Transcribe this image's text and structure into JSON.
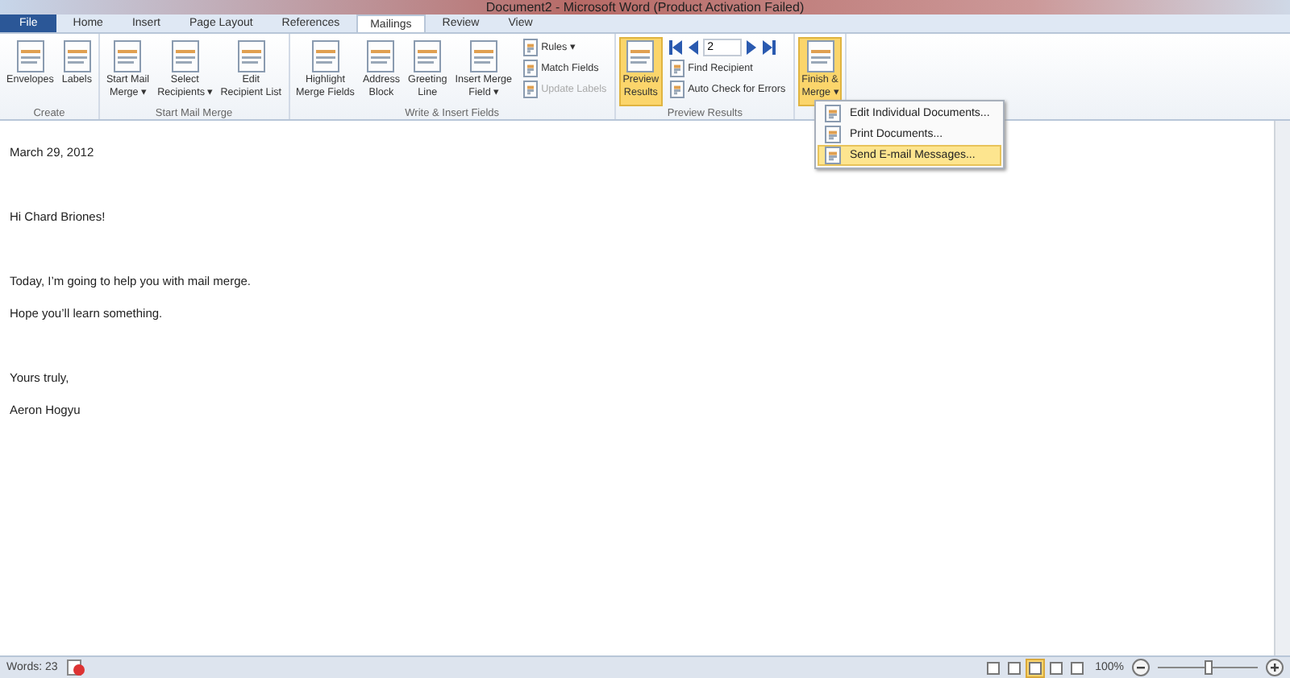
{
  "window": {
    "title": "Document2 - Microsoft Word (Product Activation Failed)"
  },
  "tabs": [
    {
      "label": "File",
      "kind": "file",
      "selected": false
    },
    {
      "label": "Home",
      "kind": "tab",
      "selected": false
    },
    {
      "label": "Insert",
      "kind": "tab",
      "selected": false
    },
    {
      "label": "Page Layout",
      "kind": "tab",
      "selected": false
    },
    {
      "label": "References",
      "kind": "tab",
      "selected": false
    },
    {
      "label": "Mailings",
      "kind": "tab",
      "selected": true
    },
    {
      "label": "Review",
      "kind": "tab",
      "selected": false
    },
    {
      "label": "View",
      "kind": "tab",
      "selected": false
    }
  ],
  "ribbon": {
    "groups": [
      {
        "label": "Create",
        "items": [
          {
            "kind": "large",
            "label": "Envelopes",
            "selected": false
          },
          {
            "kind": "large",
            "label": "Labels",
            "selected": false
          }
        ]
      },
      {
        "label": "Start Mail Merge",
        "items": [
          {
            "kind": "large",
            "label": "Start Mail\nMerge ▾",
            "selected": false
          },
          {
            "kind": "large",
            "label": "Select\nRecipients ▾",
            "selected": false
          },
          {
            "kind": "large",
            "label": "Edit\nRecipient List",
            "selected": false
          }
        ]
      },
      {
        "label": "Write & Insert Fields",
        "items": [
          {
            "kind": "large",
            "label": "Highlight\nMerge Fields",
            "selected": false
          },
          {
            "kind": "large",
            "label": "Address\nBlock",
            "selected": false
          },
          {
            "kind": "large",
            "label": "Greeting\nLine",
            "selected": false
          },
          {
            "kind": "large",
            "label": "Insert Merge\nField ▾",
            "selected": false
          },
          {
            "kind": "stack",
            "items": [
              {
                "label": "Rules ▾",
                "disabled": false
              },
              {
                "label": "Match Fields",
                "disabled": false
              },
              {
                "label": "Update Labels",
                "disabled": true
              }
            ]
          }
        ]
      },
      {
        "label": "Preview Results",
        "items": [
          {
            "kind": "large",
            "label": "Preview\nResults",
            "selected": true
          },
          {
            "kind": "nav",
            "record": "2",
            "items": [
              {
                "label": "Find Recipient",
                "disabled": false
              },
              {
                "label": "Auto Check for Errors",
                "disabled": false
              }
            ]
          }
        ]
      },
      {
        "items": [
          {
            "kind": "large",
            "label": "Finish &\nMerge ▾",
            "selected": true
          }
        ]
      }
    ]
  },
  "menu": {
    "items": [
      {
        "label": "Edit Individual Documents...",
        "selected": false
      },
      {
        "label": "Print Documents...",
        "selected": false
      },
      {
        "label": "Send E-mail Messages...",
        "selected": true
      }
    ]
  },
  "document": {
    "blocks": [
      [
        "March 29, 2012"
      ],
      [
        "Hi Chard Briones!"
      ],
      [
        "Today, I’m going to help you with mail merge.",
        "Hope you’ll learn something."
      ],
      [
        "Yours truly,",
        "Aeron Hogyu"
      ]
    ]
  },
  "status_bar": {
    "words": "Words: 23",
    "zoom": "100%",
    "zoom_slider": {
      "level": 0.5
    }
  }
}
